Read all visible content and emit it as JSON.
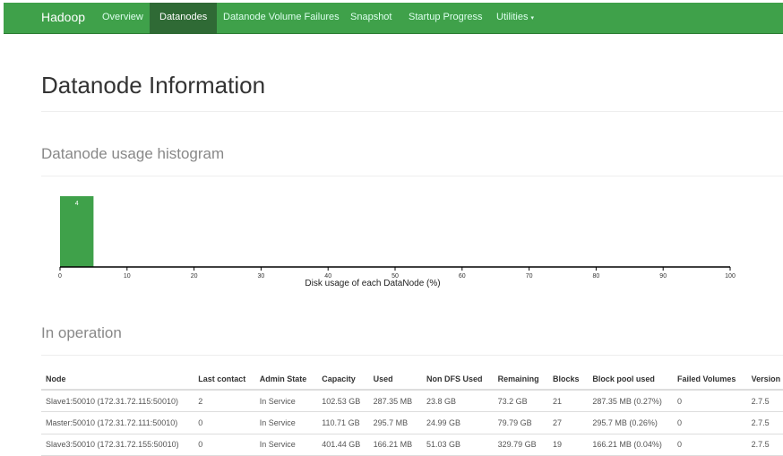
{
  "nav": {
    "brand": "Hadoop",
    "items": [
      "Overview",
      "Datanodes",
      "Datanode Volume Failures",
      "Snapshot",
      "Startup Progress",
      "Utilities"
    ],
    "active": "Datanodes",
    "accent": "#3fa14a"
  },
  "page_title": "Datanode Information",
  "histogram": {
    "title": "Datanode usage histogram"
  },
  "chart_data": {
    "type": "bar",
    "xlabel": "Disk usage of each DataNode (%)",
    "xlim": [
      0,
      100
    ],
    "xticks": [
      0,
      10,
      20,
      30,
      40,
      50,
      60,
      70,
      80,
      90,
      100
    ],
    "bins": [
      {
        "x0": 0,
        "x1": 5,
        "count": 4
      }
    ],
    "color": "#3fa14a"
  },
  "in_operation": {
    "title": "In operation",
    "columns": [
      "Node",
      "Last contact",
      "Admin State",
      "Capacity",
      "Used",
      "Non DFS Used",
      "Remaining",
      "Blocks",
      "Block pool used",
      "Failed Volumes",
      "Version"
    ],
    "rows": [
      [
        "Slave1:50010 (172.31.72.115:50010)",
        "2",
        "In Service",
        "102.53 GB",
        "287.35 MB",
        "23.8 GB",
        "73.2 GB",
        "21",
        "287.35 MB (0.27%)",
        "0",
        "2.7.5"
      ],
      [
        "Master:50010 (172.31.72.111:50010)",
        "0",
        "In Service",
        "110.71 GB",
        "295.7 MB",
        "24.99 GB",
        "79.79 GB",
        "27",
        "295.7 MB (0.26%)",
        "0",
        "2.7.5"
      ],
      [
        "Slave3:50010 (172.31.72.155:50010)",
        "0",
        "In Service",
        "401.44 GB",
        "166.21 MB",
        "51.03 GB",
        "329.79 GB",
        "19",
        "166.21 MB (0.04%)",
        "0",
        "2.7.5"
      ]
    ]
  }
}
